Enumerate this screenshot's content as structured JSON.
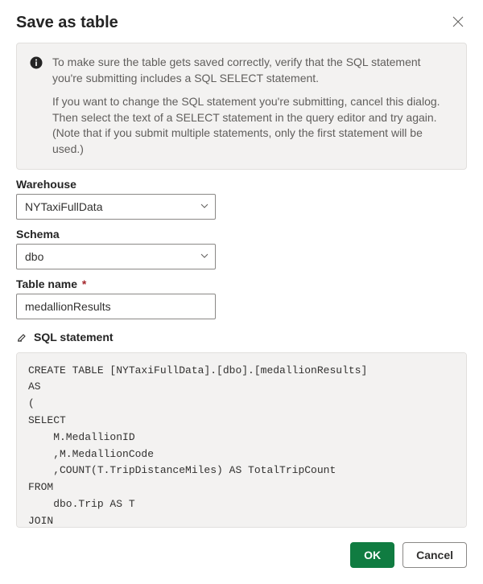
{
  "dialog": {
    "title": "Save as table",
    "info": {
      "p1": "To make sure the table gets saved correctly, verify that the SQL statement you're submitting includes a SQL SELECT statement.",
      "p2": "If you want to change the SQL statement you're submitting, cancel this dialog. Then select the text of a SELECT statement in the query editor and try again. (Note that if you submit multiple statements, only the first statement will be used.)"
    },
    "warehouse": {
      "label": "Warehouse",
      "value": "NYTaxiFullData"
    },
    "schema": {
      "label": "Schema",
      "value": "dbo"
    },
    "tableName": {
      "label": "Table name",
      "required": "*",
      "value": "medallionResults"
    },
    "sqlSection": {
      "label": "SQL statement",
      "code": "CREATE TABLE [NYTaxiFullData].[dbo].[medallionResults]\nAS\n(\nSELECT\n    M.MedallionID\n    ,M.MedallionCode\n    ,COUNT(T.TripDistanceMiles) AS TotalTripCount\nFROM\n    dbo.Trip AS T\nJOIN\n"
    },
    "buttons": {
      "ok": "OK",
      "cancel": "Cancel"
    }
  }
}
